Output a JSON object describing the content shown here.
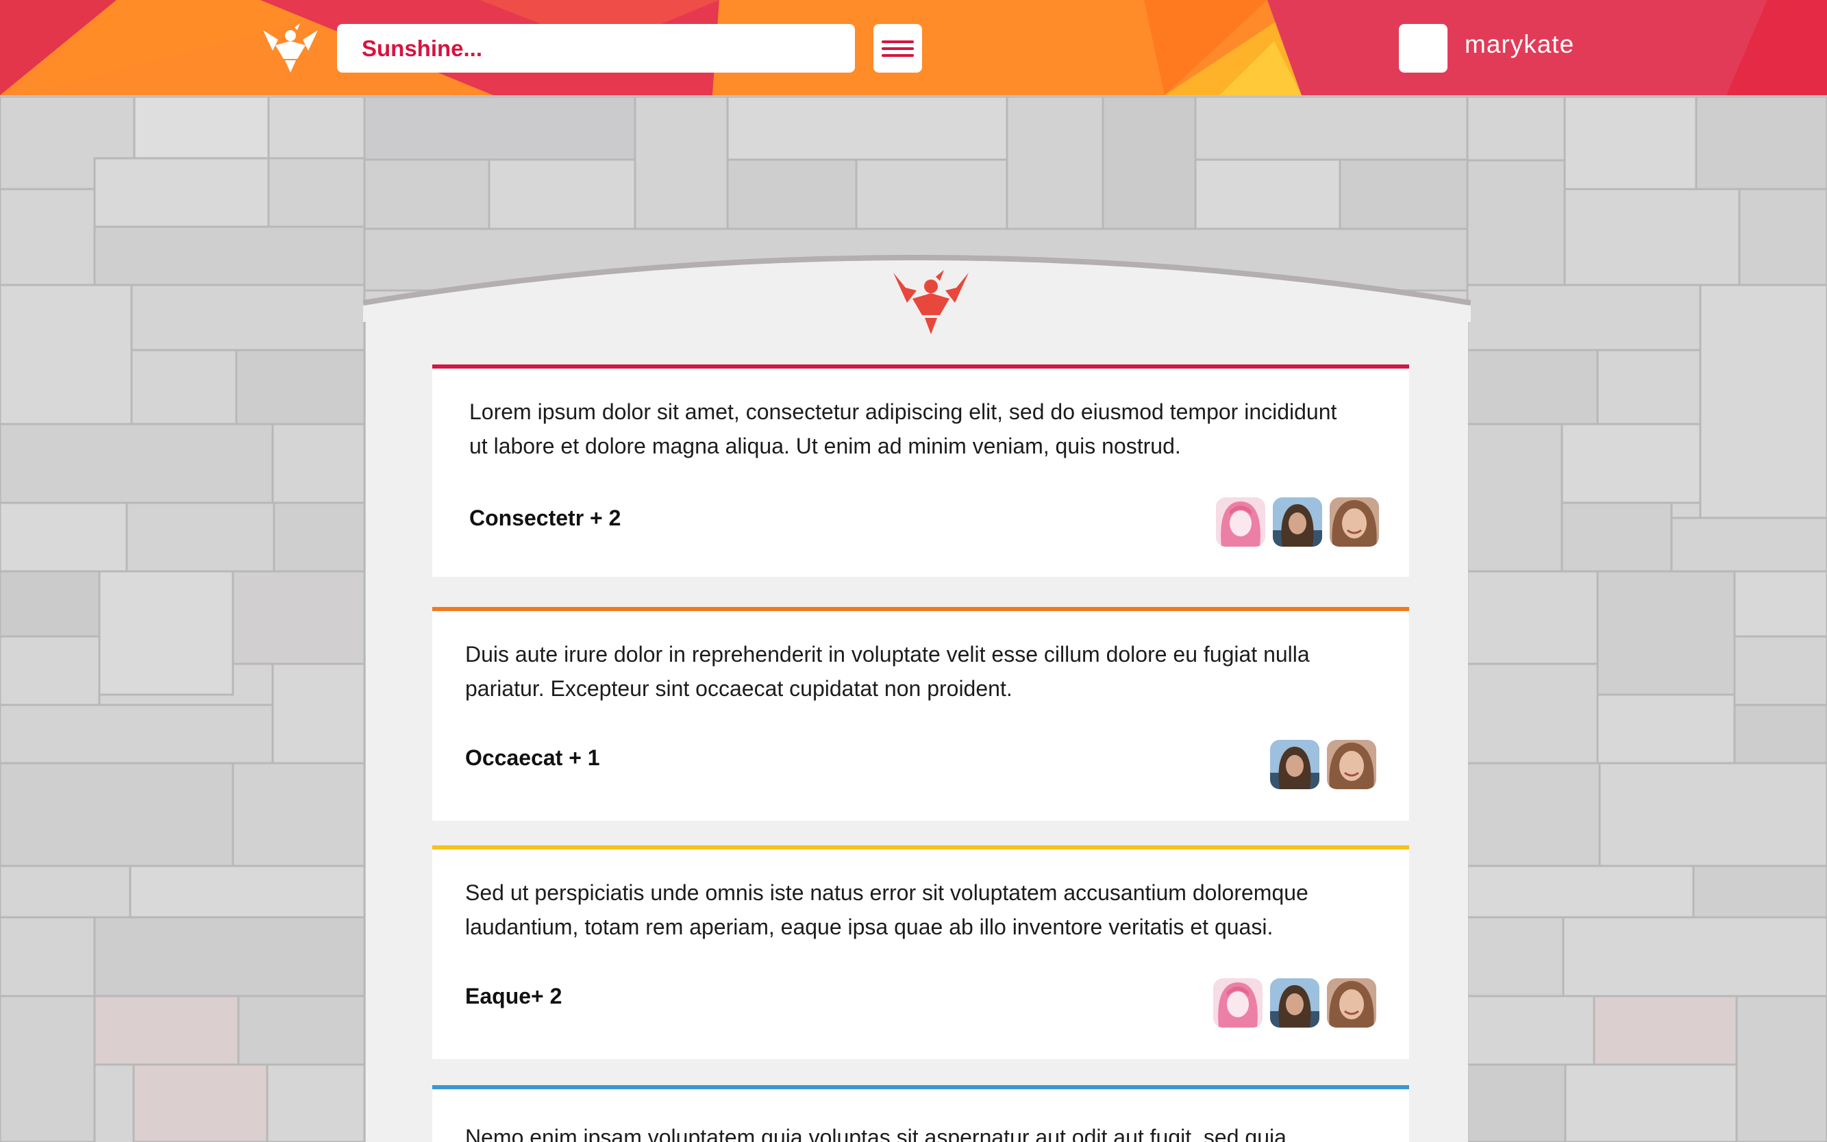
{
  "header": {
    "search_placeholder": "Sunshine...",
    "username": "marykate",
    "icons": {
      "logo": "winged-figure-logo",
      "menu": "hamburger-menu-icon",
      "avatar": "user-avatar-placeholder"
    }
  },
  "colors": {
    "brand_red": "#d6143f",
    "brand_orange": "#ff8a2a",
    "logo_red": "#e8473c",
    "card_border_1": "#cf1846",
    "card_border_2": "#f07a1f",
    "card_border_3": "#f7c21a",
    "card_border_4": "#3a98cf"
  },
  "cards": [
    {
      "text": "Lorem ipsum dolor sit amet, consectetur adipiscing elit, sed do eiusmod tempor incididunt ut labore et dolore magna aliqua. Ut enim ad minim veniam, quis nostrud.",
      "meta": "Consectetr + 2",
      "avatars": [
        "pink-illustrated-avatar",
        "photo-avatar-dark-hair",
        "photo-avatar-light-hair"
      ]
    },
    {
      "text": "Duis aute irure dolor in reprehenderit in voluptate velit esse cillum dolore eu fugiat nulla pariatur. Excepteur sint occaecat cupidatat non proident.",
      "meta": "Occaecat + 1",
      "avatars": [
        "photo-avatar-dark-hair",
        "photo-avatar-light-hair"
      ]
    },
    {
      "text": "Sed ut perspiciatis unde omnis iste natus error sit voluptatem accusantium doloremque laudantium, totam rem aperiam, eaque ipsa quae ab illo inventore veritatis et quasi.",
      "meta": "Eaque+ 2",
      "avatars": [
        "pink-illustrated-avatar",
        "photo-avatar-dark-hair",
        "photo-avatar-light-hair"
      ]
    },
    {
      "text": "Nemo enim ipsam voluptatem quia voluptas sit aspernatur aut odit aut fugit, sed quia"
    }
  ]
}
